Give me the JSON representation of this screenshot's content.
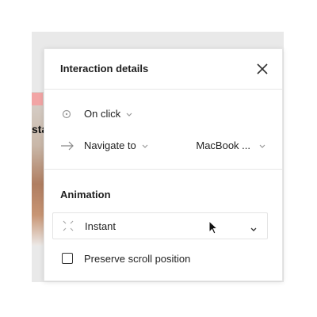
{
  "panel": {
    "title": "Interaction details",
    "close_icon": "close-icon"
  },
  "trigger": {
    "icon": "circle-trigger-icon",
    "label": "On click"
  },
  "action": {
    "icon": "arrow-right-icon",
    "label": "Navigate to",
    "destination": "MacBook ..."
  },
  "animation": {
    "section_title": "Animation",
    "icon": "instant-transition-icon",
    "selected": "Instant"
  },
  "preserve_scroll": {
    "label": "Preserve scroll position",
    "checked": false
  },
  "canvas": {
    "tag_text": "",
    "frame_text": "sta"
  }
}
